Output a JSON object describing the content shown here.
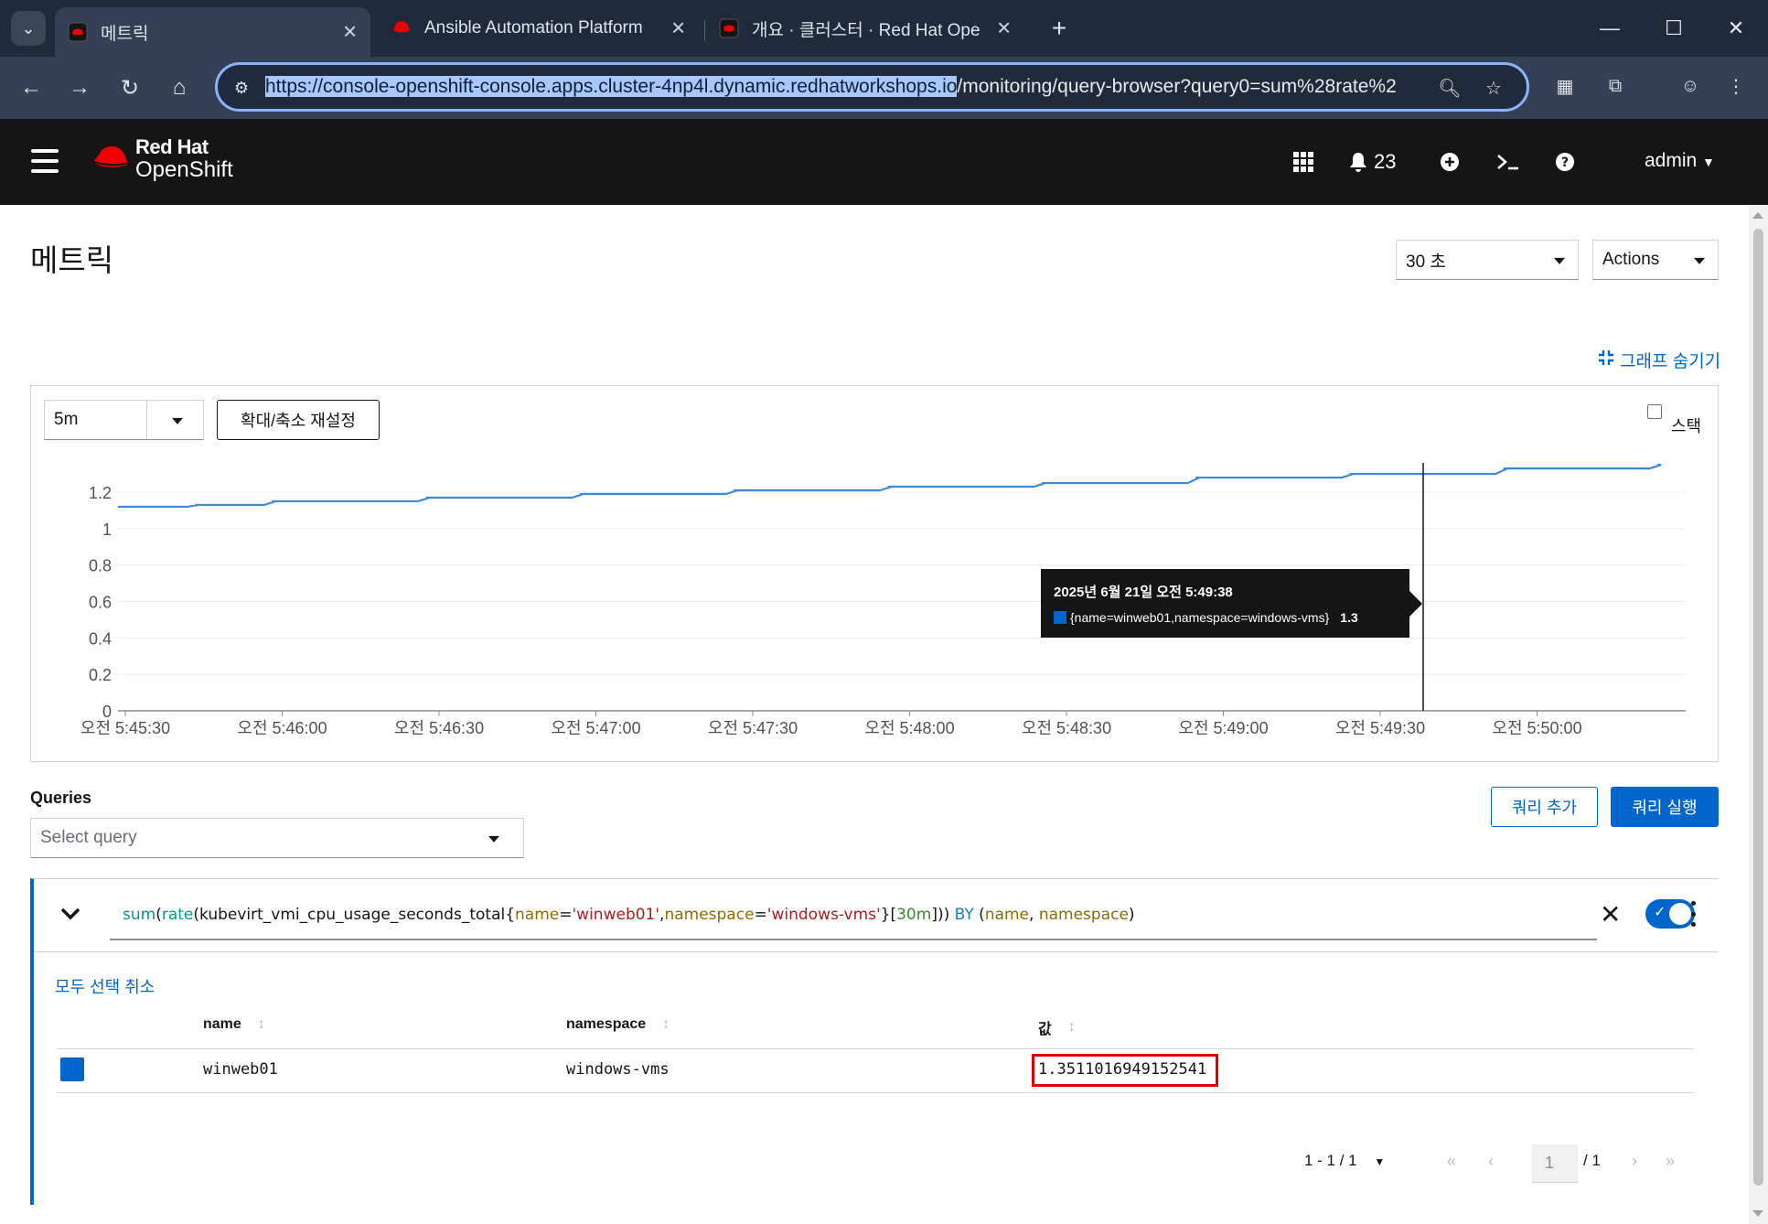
{
  "browser": {
    "tabs": [
      {
        "title": "메트릭",
        "active": true
      },
      {
        "title": "Ansible Automation Platform",
        "active": false
      },
      {
        "title": "개요 · 클러스터 · Red Hat Ope",
        "active": false
      }
    ],
    "url_selected": "https://console-openshift-console.apps.cluster-4np4l.dynamic.redhatworkshops.io",
    "url_rest": "/monitoring/query-browser?query0=sum%28rate%2"
  },
  "masthead": {
    "brand_line1": "Red Hat",
    "brand_line2": "OpenShift",
    "notifications_count": "23",
    "user": "admin"
  },
  "page": {
    "title": "메트릭",
    "refresh_interval": "30 초",
    "actions_label": "Actions",
    "hide_graph_label": "그래프 숨기기"
  },
  "graph": {
    "time_range": "5m",
    "reset_zoom_label": "확대/축소 재설정",
    "stack_label": "스택",
    "tooltip_title": "2025년 6월 21일 오전 5:49:38",
    "tooltip_series": "{name=winweb01,namespace=windows-vms}",
    "tooltip_value": "1.3"
  },
  "chart_data": {
    "type": "line",
    "x_ticks": [
      "오전 5:45:30",
      "오전 5:46:00",
      "오전 5:46:30",
      "오전 5:47:00",
      "오전 5:47:30",
      "오전 5:48:00",
      "오전 5:48:30",
      "오전 5:49:00",
      "오전 5:49:30",
      "오전 5:50:00"
    ],
    "y_ticks": [
      "0",
      "0.2",
      "0.4",
      "0.6",
      "0.8",
      "1",
      "1.2"
    ],
    "ylim": [
      0,
      1.3
    ],
    "series": [
      {
        "name": "{name=winweb01,namespace=windows-vms}",
        "color": "#3f8ad8",
        "x": [
          "5:45:30",
          "5:45:45",
          "5:46:00",
          "5:46:15",
          "5:46:30",
          "5:46:45",
          "5:47:00",
          "5:47:15",
          "5:47:30",
          "5:47:45",
          "5:48:00",
          "5:48:15",
          "5:48:30",
          "5:48:45",
          "5:49:00",
          "5:49:15",
          "5:49:30",
          "5:49:45",
          "5:50:00",
          "5:50:15",
          "5:50:30"
        ],
        "values": [
          1.12,
          1.13,
          1.15,
          1.15,
          1.17,
          1.17,
          1.19,
          1.19,
          1.21,
          1.21,
          1.23,
          1.23,
          1.25,
          1.25,
          1.28,
          1.28,
          1.3,
          1.3,
          1.33,
          1.33,
          1.35
        ]
      }
    ]
  },
  "queries": {
    "label": "Queries",
    "select_placeholder": "Select query",
    "add_query_label": "쿼리 추가",
    "run_query_label": "쿼리 실행",
    "expression": {
      "p1": "sum",
      "p2": "(",
      "p3": "rate",
      "p4": "(kubevirt_vmi_cpu_usage_seconds_total{",
      "p5": "name",
      "p6": "=",
      "p7": "'winweb01'",
      "p8": ",",
      "p9": "namespace",
      "p10": "=",
      "p11": "'windows-vms'",
      "p12": "}[",
      "p13": "30m",
      "p14": "])) ",
      "p15": "BY",
      "p16": " (",
      "p17": "name",
      "p18": ", ",
      "p19": "namespace",
      "p20": ")"
    },
    "unselect_all_label": "모두 선택 취소",
    "table": {
      "headers": [
        "name",
        "namespace",
        "값"
      ],
      "rows": [
        {
          "name": "winweb01",
          "namespace": "windows-vms",
          "value": "1.3511016949152541",
          "color": "#0066cc"
        }
      ]
    },
    "pagination": {
      "range": "1 - 1 / 1",
      "current_page": "1",
      "total_pages": "/ 1"
    }
  }
}
